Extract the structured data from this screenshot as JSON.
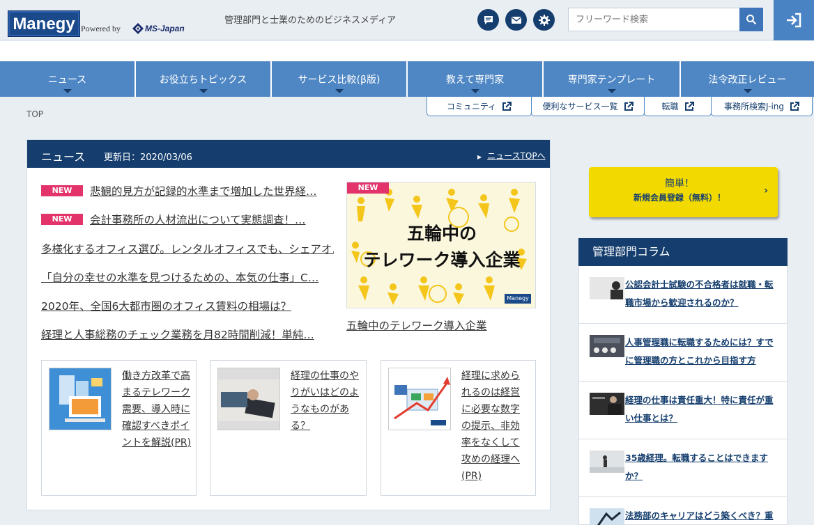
{
  "header": {
    "logo": "Manegy",
    "powered_by": "Powered by",
    "company": "MS-Japan",
    "tagline": "管理部門と士業のためのビジネスメディア",
    "search_placeholder": "フリーワード検索",
    "icons": [
      "chat-icon",
      "mail-icon",
      "gear-icon",
      "search-icon",
      "login-icon"
    ]
  },
  "nav": {
    "items": [
      {
        "label": "ニュース"
      },
      {
        "label": "お役立ちトピックス"
      },
      {
        "label": "サービス比較(β版)"
      },
      {
        "label": "教えて専門家"
      },
      {
        "label": "専門家テンプレート"
      },
      {
        "label": "法令改正レビュー"
      }
    ]
  },
  "breadcrumb": "TOP",
  "subtabs": [
    {
      "label": "コミュニティ"
    },
    {
      "label": "便利なサービス一覧"
    },
    {
      "label": "転職"
    },
    {
      "label": "事務所検索J-ing"
    }
  ],
  "news": {
    "title": "ニュース",
    "updated": "更新日：2020/03/06",
    "top_link": "ニュースTOPへ",
    "new_label": "NEW",
    "items": [
      {
        "text": "悲観的見方が記録的水準まで増加した世界経…",
        "is_new": true
      },
      {
        "text": "会計事務所の人材流出について実態調査！…",
        "is_new": true
      },
      {
        "text": "多様化するオフィス選び。レンタルオフィスでも、シェアオ…",
        "is_new": false
      },
      {
        "text": "「自分の幸せの水準を見つけるための、本気の仕事」C…",
        "is_new": false
      },
      {
        "text": "2020年、全国6大都市圏のオフィス賃料の相場は？",
        "is_new": false
      },
      {
        "text": "経理と人事総務のチェック業務を月82時間削減！単純…",
        "is_new": false
      }
    ],
    "feature": {
      "image_line1": "五輪中の",
      "image_line2": "テレワーク導入企業",
      "image_badge": "Manegy",
      "caption": "五輪中のテレワーク導入企業"
    },
    "cards": [
      {
        "text": "働き方改革で高まるテレワーク需要、導入時に確認すべきポイントを解説(PR)"
      },
      {
        "text": "経理の仕事のやりがいはどのようなものがある？"
      },
      {
        "text": "経理に求められるのは経営に必要な数字の提示、非効率をなくして攻めの経理へ(PR)"
      }
    ]
  },
  "sidebar": {
    "signup_line1": "簡単！",
    "signup_line2": "新規会員登録（無料）！",
    "signup_arrow": "›",
    "column_title": "管理部門コラム",
    "columns": [
      {
        "text": "公認会計士試験の不合格者は就職・転職市場から歓迎されるのか？"
      },
      {
        "text": "人事管理職に転職するためには？すでに管理職の方とこれから目指す方"
      },
      {
        "text": "経理の仕事は責任重大！特に責任が重い仕事とは？"
      },
      {
        "text": "35歳経理。転職することはできますか？"
      },
      {
        "text": "法務部のキャリアはどう築くべき？重要"
      }
    ]
  },
  "colors": {
    "navy": "#153e6e",
    "nav_blue": "#4f87c5",
    "new_pink": "#e2336b",
    "signup_yellow": "#f2da00"
  }
}
